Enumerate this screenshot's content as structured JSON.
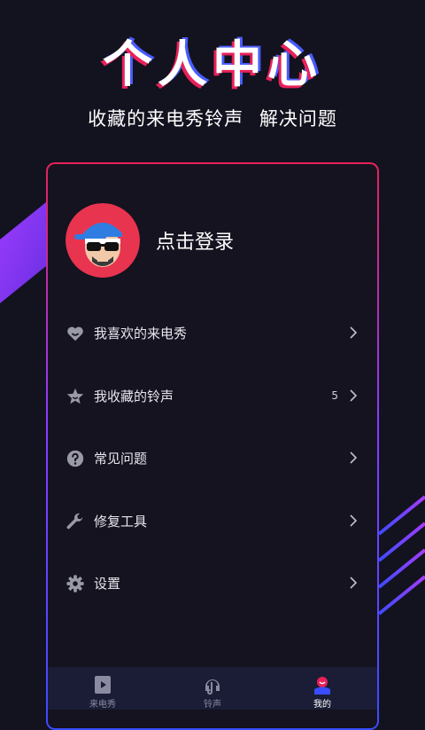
{
  "header": {
    "title": "个人中心",
    "subtitle": "收藏的来电秀铃声  解决问题"
  },
  "profile": {
    "login_label": "点击登录"
  },
  "menu": {
    "items": [
      {
        "label": "我喜欢的来电秀",
        "icon": "heart-icon",
        "count": ""
      },
      {
        "label": "我收藏的铃声",
        "icon": "star-icon",
        "count": "5"
      },
      {
        "label": "常见问题",
        "icon": "question-icon",
        "count": ""
      },
      {
        "label": "修复工具",
        "icon": "wrench-icon",
        "count": ""
      },
      {
        "label": "设置",
        "icon": "gear-icon",
        "count": ""
      }
    ]
  },
  "tabbar": {
    "tabs": [
      {
        "label": "来电秀",
        "icon": "video-icon",
        "active": false
      },
      {
        "label": "铃声",
        "icon": "music-icon",
        "active": false
      },
      {
        "label": "我的",
        "icon": "profile-icon",
        "active": true
      }
    ]
  },
  "colors": {
    "background": "#13121f",
    "accent_pink": "#e8215a",
    "accent_purple": "#8b3cff",
    "accent_blue": "#3a4cff",
    "tabbar": "#1b1d36"
  }
}
